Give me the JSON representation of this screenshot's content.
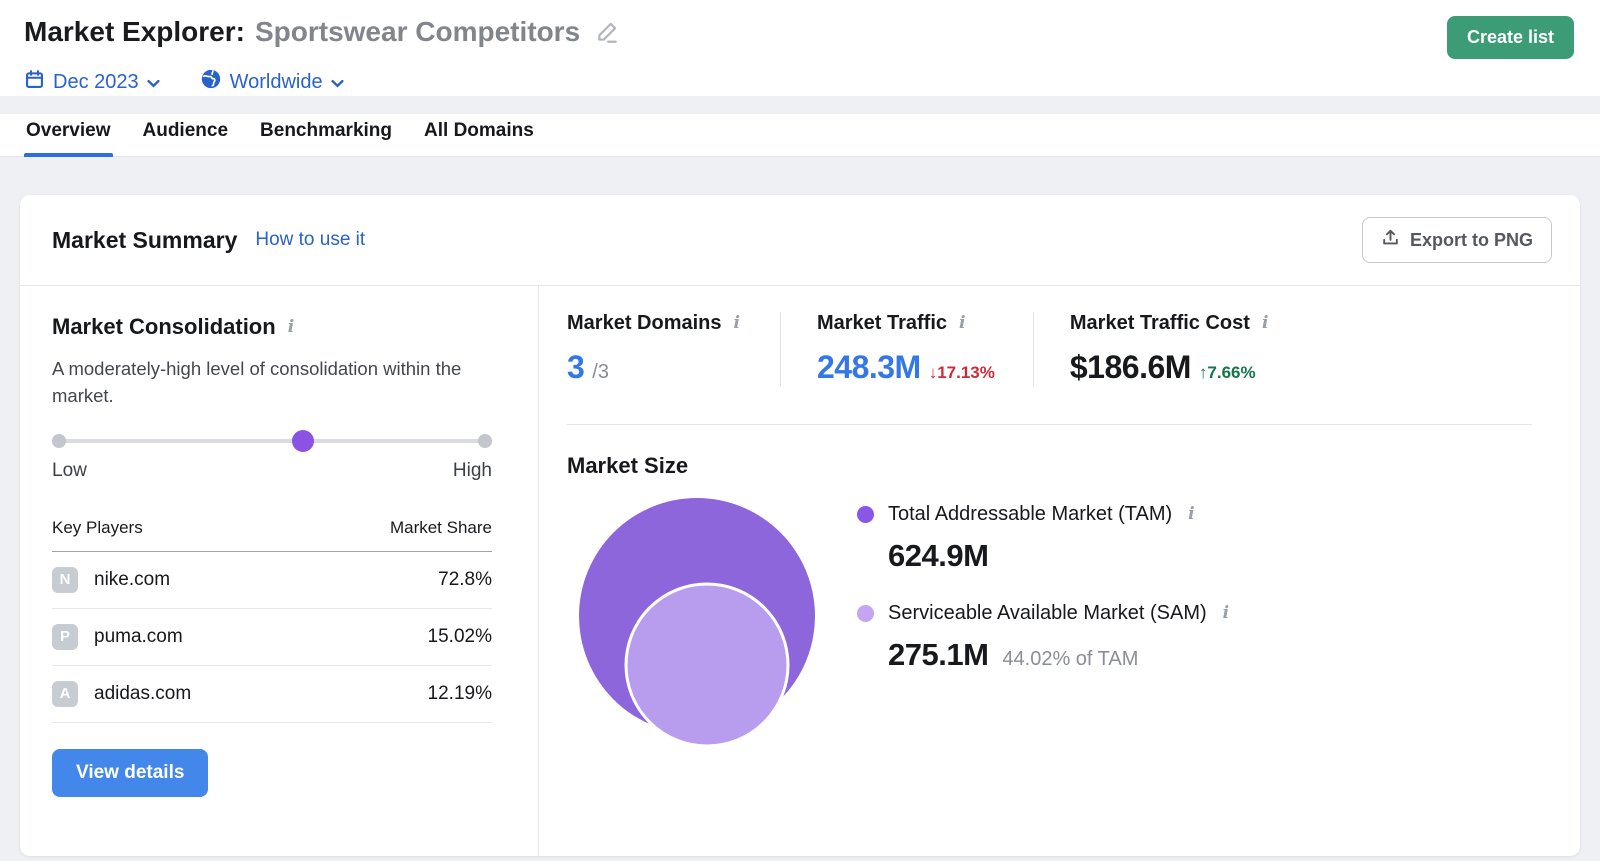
{
  "header": {
    "title_prefix": "Market Explorer:",
    "title_name": "Sportswear Competitors",
    "create_list_label": "Create list",
    "date_label": "Dec 2023",
    "region_label": "Worldwide"
  },
  "tabs": [
    {
      "label": "Overview",
      "active": true
    },
    {
      "label": "Audience",
      "active": false
    },
    {
      "label": "Benchmarking",
      "active": false
    },
    {
      "label": "All Domains",
      "active": false
    }
  ],
  "card": {
    "title": "Market Summary",
    "help_link": "How to use it",
    "export_label": "Export to PNG"
  },
  "consolidation": {
    "title": "Market Consolidation",
    "description": "A moderately-high level of consolidation within the market.",
    "slider": {
      "low_label": "Low",
      "high_label": "High",
      "value_percent": 57
    },
    "table": {
      "col_player": "Key Players",
      "col_share": "Market Share",
      "rows": [
        {
          "initial": "N",
          "domain": "nike.com",
          "share": "72.8%"
        },
        {
          "initial": "P",
          "domain": "puma.com",
          "share": "15.02%"
        },
        {
          "initial": "A",
          "domain": "adidas.com",
          "share": "12.19%"
        }
      ]
    },
    "view_details_label": "View details"
  },
  "stats": [
    {
      "label": "Market Domains",
      "value": "3",
      "suffix": "/3"
    },
    {
      "label": "Market Traffic",
      "value": "248.3M",
      "change": "↓17.13%",
      "direction": "down"
    },
    {
      "label": "Market Traffic Cost",
      "value": "$186.6M",
      "change": "↑7.66%",
      "direction": "up"
    }
  ],
  "market_size": {
    "title": "Market Size",
    "tam": {
      "label": "Total Addressable Market (TAM)",
      "value": "624.9M"
    },
    "sam": {
      "label": "Serviceable Available Market (SAM)",
      "value": "275.1M",
      "note": "44.02% of TAM"
    }
  },
  "icons": {
    "info": "i"
  },
  "colors": {
    "link_blue": "#2a62c9",
    "value_blue": "#3377e8",
    "share_blue": "#2d6ae0",
    "green_button": "#3b9c76",
    "blue_button": "#4487ea",
    "negative_red": "#cc2b39",
    "positive_green": "#17744a",
    "slider_thumb_purple": "#8a53e3",
    "tam_circle": "#8d66dc",
    "sam_circle": "#b89dee",
    "tam_dot": "#8a56e8",
    "sam_dot": "#c5a5f3"
  }
}
